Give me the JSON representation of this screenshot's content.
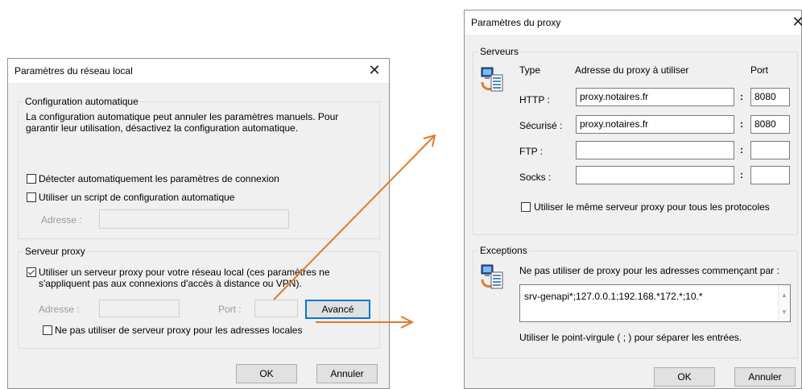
{
  "lan": {
    "title": "Paramètres du réseau local",
    "auto_group": "Configuration automatique",
    "auto_desc_1": "La configuration automatique peut annuler les paramètres manuels. Pour",
    "auto_desc_2": "garantir leur utilisation, désactivez la configuration automatique.",
    "detect_label": "Détecter automatiquement les paramètres de connexion",
    "detect_checked": false,
    "script_label": "Utiliser un script de configuration automatique",
    "script_checked": false,
    "address_label": "Adresse :",
    "address_value": "",
    "proxy_group": "Serveur proxy",
    "use_proxy_label_1": "Utiliser un serveur proxy pour votre réseau local (ces paramètres ne",
    "use_proxy_label_2": "s'appliquent pas aux connexions d'accès à distance ou VPN).",
    "use_proxy_checked": true,
    "proxy_address_label": "Adresse :",
    "proxy_address_value": "",
    "port_label": "Port :",
    "port_value": "",
    "advanced_button": "Avancé",
    "bypass_local_label": "Ne pas utiliser de serveur proxy pour les adresses locales",
    "bypass_local_checked": false,
    "ok_button": "OK",
    "cancel_button": "Annuler"
  },
  "proxy": {
    "title": "Paramètres du proxy",
    "servers_group": "Serveurs",
    "col_type": "Type",
    "col_address": "Adresse du proxy à utiliser",
    "col_port": "Port",
    "rows": [
      {
        "type": "HTTP :",
        "address": "proxy.notaires.fr",
        "port": "8080"
      },
      {
        "type": "Sécurisé :",
        "address": "proxy.notaires.fr",
        "port": "8080"
      },
      {
        "type": "FTP :",
        "address": "",
        "port": ""
      },
      {
        "type": "Socks :",
        "address": "",
        "port": ""
      }
    ],
    "colon": ":",
    "same_proxy_label": "Utiliser le même serveur proxy pour tous les protocoles",
    "same_proxy_checked": false,
    "exceptions_group": "Exceptions",
    "exceptions_desc": "Ne pas utiliser de proxy pour les adresses commençant par :",
    "exceptions_value": "srv-genapi*;127.0.0.1;192.168.*172.*;10.*",
    "separator_hint": "Utiliser le point-virgule ( ; ) pour séparer les entrées.",
    "ok_button": "OK",
    "cancel_button": "Annuler"
  },
  "icons": {
    "close": "close-icon",
    "network": "network-computer-icon",
    "annotation": "orange-arrow"
  },
  "colors": {
    "dialog_bg": "#f0f0f0",
    "accent": "#0078d7",
    "arrow": "#e07b2b"
  },
  "glyphs": {
    "close": "✕",
    "scroll_up": "▲",
    "scroll_down": "▼"
  }
}
